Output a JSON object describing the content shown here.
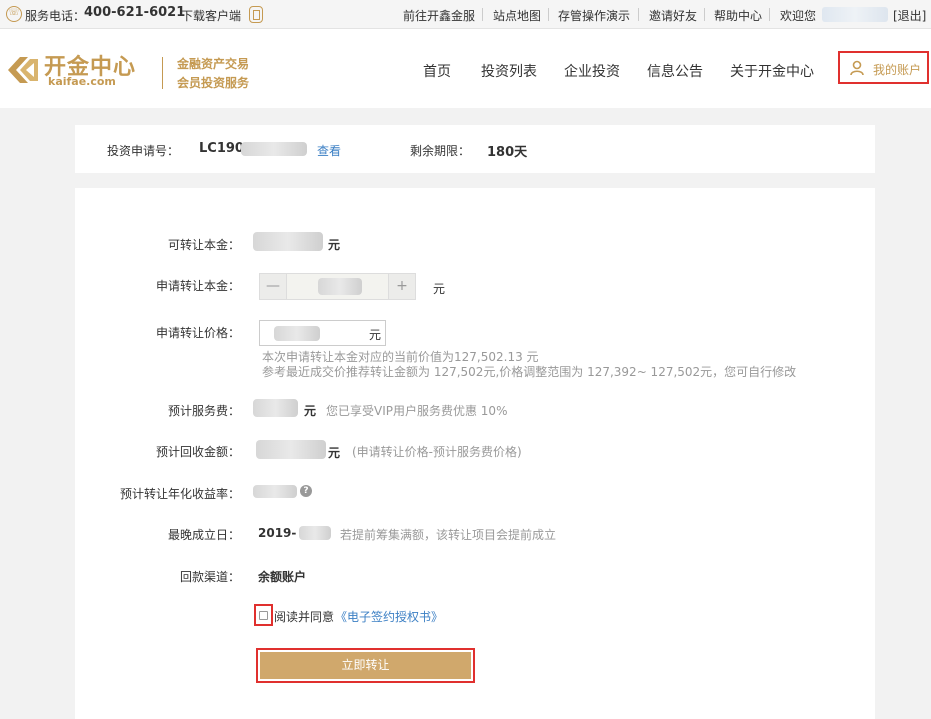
{
  "topbar": {
    "service_label": "服务电话：",
    "service_phone": "400-621-6021",
    "download": "下载客户端",
    "links": [
      "前往开鑫金服",
      "站点地图",
      "存管操作演示",
      "邀请好友",
      "帮助中心"
    ],
    "welcome": "欢迎您",
    "logout": "[退出]"
  },
  "header": {
    "logo_text": "开金中心",
    "logo_sub": "kaifae.com",
    "slogan_line1": "金融资产交易",
    "slogan_line2": "会员投资服务",
    "nav": [
      "首页",
      "投资列表",
      "企业投资",
      "信息公告",
      "关于开金中心"
    ],
    "account_label": "我的账户"
  },
  "info": {
    "apply_no_label": "投资申请号：",
    "apply_no_prefix": "LC190",
    "view_link": "查看",
    "remaining_label": "剩余期限：",
    "remaining_value": "180天"
  },
  "form": {
    "transferable_label": "可转让本金：",
    "transferable_unit": "元",
    "apply_principal_label": "申请转让本金：",
    "apply_principal_unit": "元",
    "stepper_minus": "—",
    "stepper_plus": "+",
    "apply_price_label": "申请转让价格：",
    "apply_price_unit": "元",
    "price_hint1": "本次申请转让本金对应的当前价值为127,502.13 元",
    "price_hint2": "参考最近成交价推荐转让金额为 127,502元,价格调整范围为 127,392~ 127,502元，您可自行修改",
    "fee_label": "预计服务费：",
    "fee_unit": "元",
    "fee_hint": "您已享受VIP用户服务费优惠 10%",
    "receive_label": "预计回收金额：",
    "receive_unit": "元",
    "receive_hint": "(申请转让价格-预计服务费价格)",
    "annual_label": "预计转让年化收益率：",
    "latest_date_label": "最晚成立日：",
    "latest_date_value": "2019-",
    "latest_date_hint": "若提前筹集满额，该转让项目会提前成立",
    "channel_label": "回款渠道：",
    "channel_value": "余额账户",
    "agree_text": "阅读并同意",
    "agree_link": "《电子签约授权书》",
    "submit_label": "立即转让"
  },
  "colors": {
    "brand_gold": "#c59a52",
    "button_gold": "#d0a86c",
    "highlight_red": "#e0302e",
    "link_blue": "#3b7fc4"
  }
}
